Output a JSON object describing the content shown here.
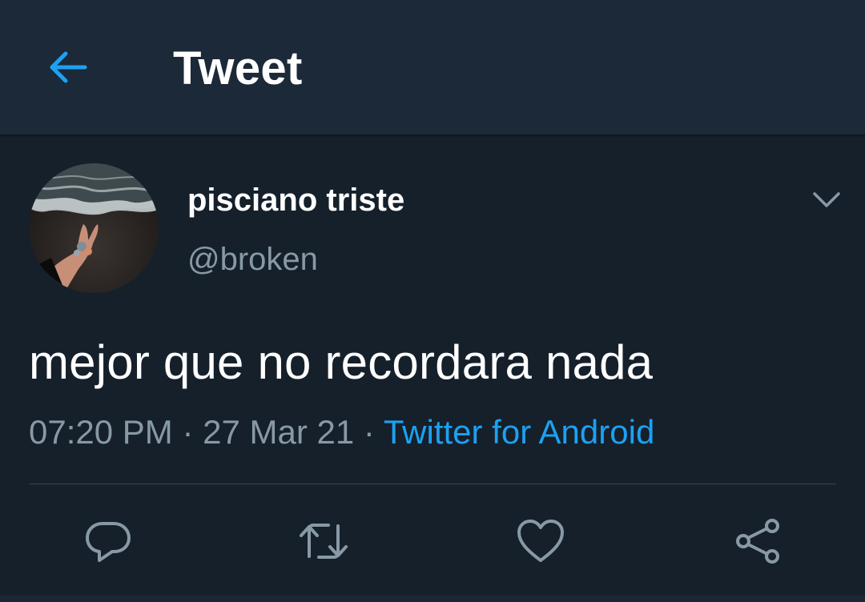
{
  "header": {
    "title": "Tweet",
    "back_icon": "arrow-left-icon"
  },
  "tweet": {
    "author": {
      "display_name": "pisciano triste",
      "handle": "@broken"
    },
    "text": "mejor que no recordara nada",
    "time": "07:20 PM",
    "separator": "·",
    "date": "27 Mar 21",
    "source": "Twitter for Android"
  },
  "actions": [
    {
      "name": "reply",
      "icon": "reply-icon"
    },
    {
      "name": "retweet",
      "icon": "retweet-icon"
    },
    {
      "name": "like",
      "icon": "heart-icon"
    },
    {
      "name": "share",
      "icon": "share-icon"
    }
  ],
  "colors": {
    "background": "#15202b",
    "header_background": "#1c2938",
    "accent": "#1da1f2",
    "secondary_text": "#8899a6",
    "icon": "#8899a6",
    "divider": "#38444d"
  }
}
